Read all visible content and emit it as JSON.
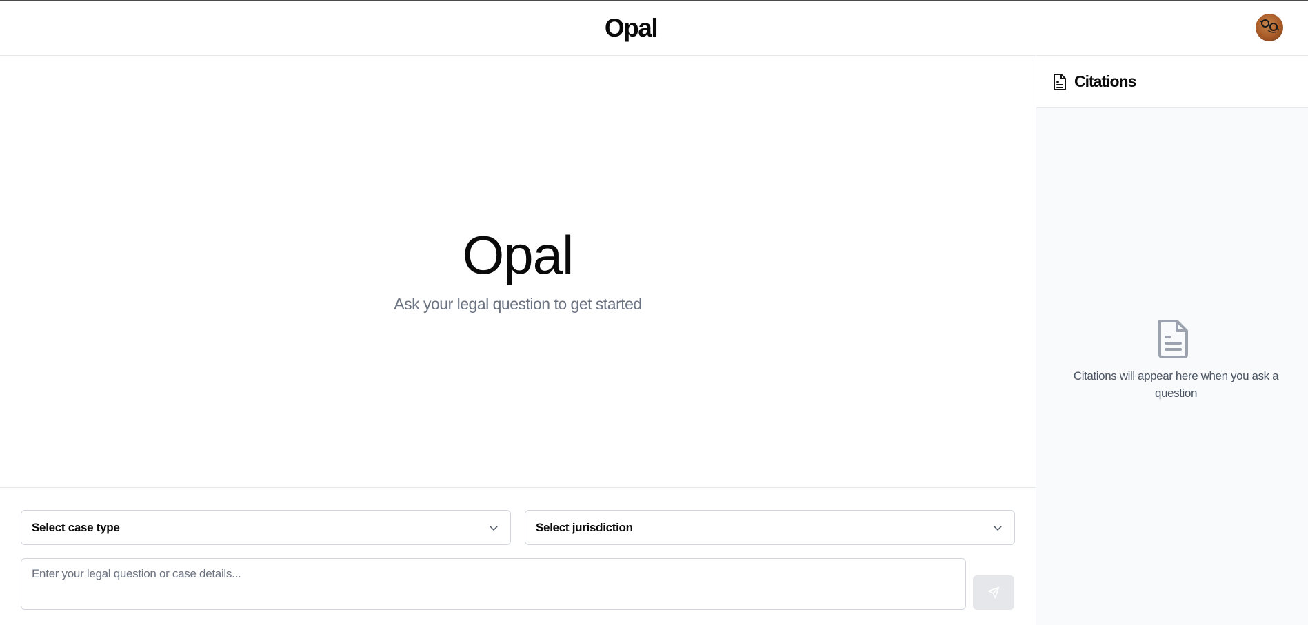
{
  "header": {
    "brand": "Opal"
  },
  "hero": {
    "title": "Opal",
    "subtitle": "Ask your legal question to get started"
  },
  "composer": {
    "case_type_select": {
      "selected": "Select case type"
    },
    "jurisdiction_select": {
      "selected": "Select jurisdiction"
    },
    "question_input": {
      "value": "",
      "placeholder": "Enter your legal question or case details..."
    },
    "send_icon": "send-icon"
  },
  "sidebar": {
    "title": "Citations",
    "header_icon": "document-icon",
    "empty_icon": "document-icon",
    "empty_message": "Citations will appear here when you ask a question"
  },
  "colors": {
    "muted_text": "#6b7280",
    "border": "#e5e7eb",
    "sidebar_bg": "#f9fafb",
    "send_disabled": "#e5e7eb"
  }
}
